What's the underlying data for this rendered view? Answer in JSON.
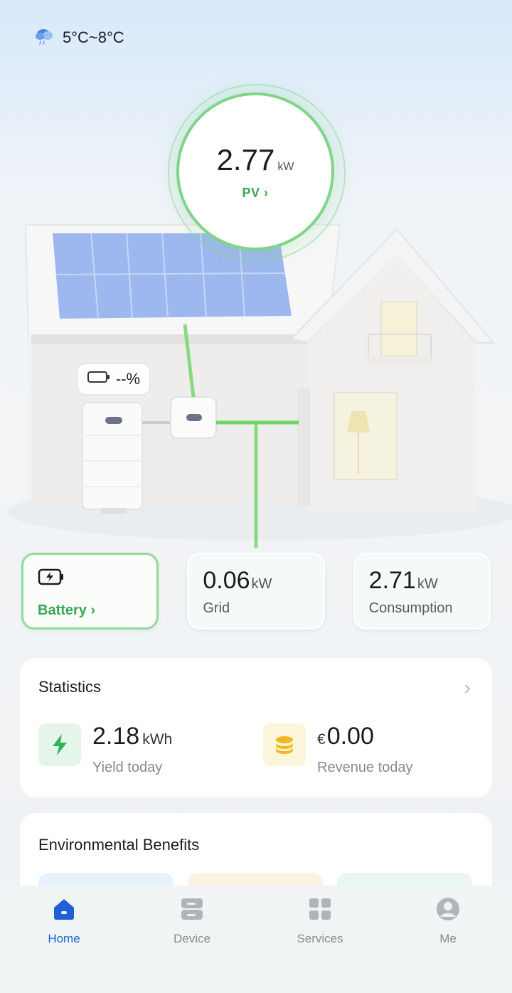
{
  "weather": {
    "icon": "cloud-rain-icon",
    "temp_range": "5°C~8°C"
  },
  "pv": {
    "value": "2.77",
    "unit": "kW",
    "label": "PV",
    "chevron": "›"
  },
  "battery_badge": {
    "icon": "battery-icon",
    "value": "--%"
  },
  "cards": {
    "battery": {
      "label": "Battery",
      "chevron": "›",
      "icon": "battery-charging-icon"
    },
    "grid": {
      "value": "0.06",
      "unit": "kW",
      "label": "Grid"
    },
    "consumption": {
      "value": "2.71",
      "unit": "kW",
      "label": "Consumption"
    }
  },
  "statistics": {
    "title": "Statistics",
    "chevron": "›",
    "yield": {
      "value": "2.18",
      "unit": "kWh",
      "label": "Yield today",
      "icon": "lightning-icon"
    },
    "revenue": {
      "currency": "€",
      "value": "0.00",
      "label": "Revenue today",
      "icon": "coins-icon"
    }
  },
  "environmental": {
    "title": "Environmental Benefits"
  },
  "tabs": [
    {
      "label": "Home",
      "icon": "home-icon",
      "active": true
    },
    {
      "label": "Device",
      "icon": "device-icon",
      "active": false
    },
    {
      "label": "Services",
      "icon": "grid-icon",
      "active": false
    },
    {
      "label": "Me",
      "icon": "user-icon",
      "active": false
    }
  ],
  "colors": {
    "accent_green": "#3aa653",
    "active_blue": "#1e5fd6",
    "pv_ring": "#7fd48a"
  }
}
